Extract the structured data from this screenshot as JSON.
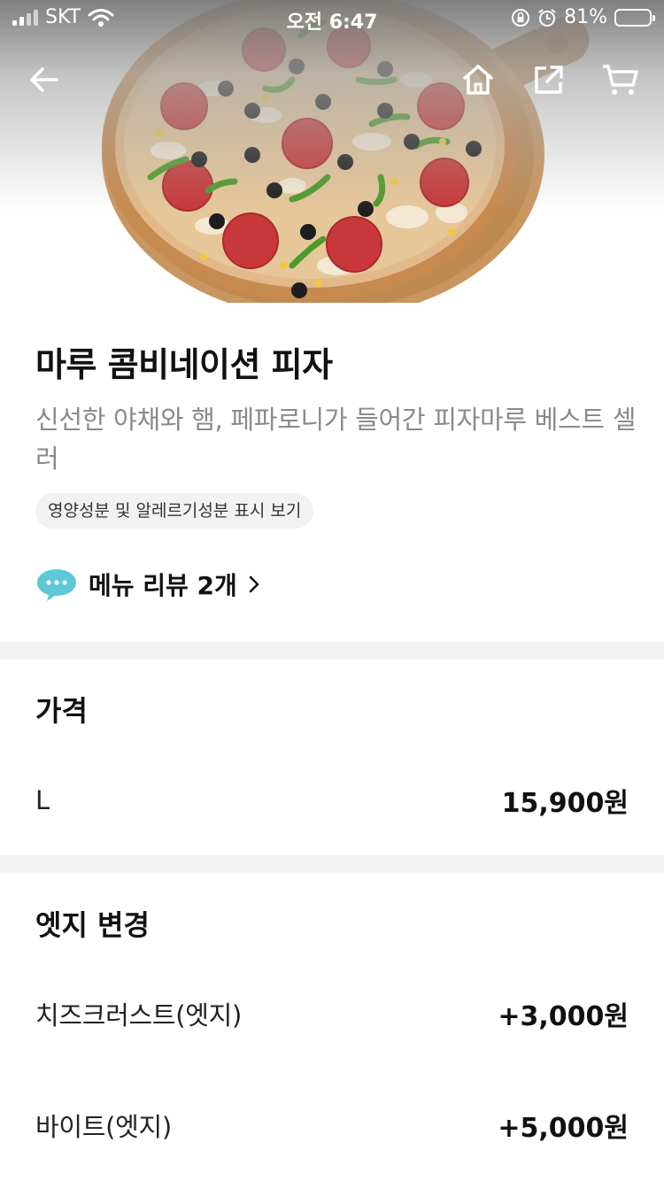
{
  "status_bar": {
    "carrier": "SKT",
    "time": "오전 6:47",
    "battery": "81%",
    "battery_level": 0.81
  },
  "nav": {
    "back_icon": "arrow-left-icon",
    "home_icon": "home-icon",
    "share_icon": "share-icon",
    "cart_icon": "cart-icon"
  },
  "product": {
    "title": "마루 콤비네이션 피자",
    "description": "신선한 야채와 햄, 페파로니가 들어간 피자마루 베스트 셀러",
    "nutrition_link": "영양성분 및 알레르기성분 표시 보기",
    "review_link": "메뉴 리뷰 2개"
  },
  "price_section": {
    "title": "가격",
    "options": [
      {
        "name": "L",
        "price": "15,900원"
      }
    ]
  },
  "edge_section": {
    "title": "엣지 변경",
    "options": [
      {
        "name": "치즈크러스트(엣지)",
        "price": "+3,000원"
      },
      {
        "name": "바이트(엣지)",
        "price": "+5,000원"
      }
    ]
  },
  "colors": {
    "accent_bubble": "#5ec8d6",
    "divider": "#f2f2f2",
    "muted_text": "#8a8a8a"
  }
}
